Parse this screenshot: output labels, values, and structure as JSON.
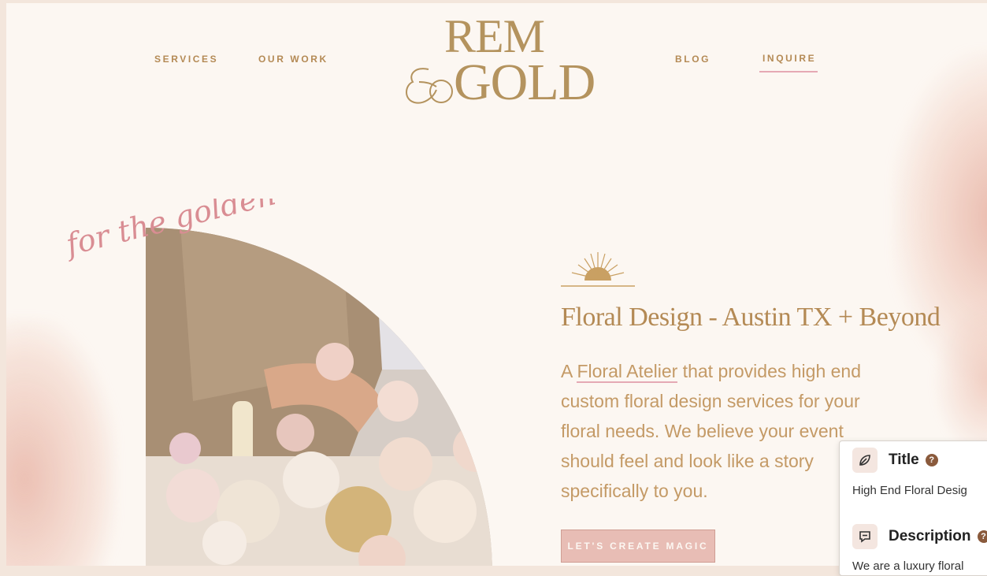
{
  "nav": {
    "services": "SERVICES",
    "our_work": "OUR WORK",
    "blog": "BLOG",
    "inquire": "INQUIRE"
  },
  "logo": {
    "line1": "REM",
    "line2": "GOLD",
    "alt": "Remi & Gold"
  },
  "hero": {
    "script_text": "for the golden",
    "headline": "Floral Design - Austin TX + Beyond",
    "body_prefix": "A ",
    "body_link": "Floral Atelier",
    "body_suffix": " that provides high end custom floral design services for your floral needs. We believe your event should feel and look like a story specifically to you.",
    "cta": "LET'S CREATE MAGIC"
  },
  "seo_panel": {
    "title_label": "Title",
    "title_value": "High End Floral Desig",
    "description_label": "Description",
    "description_value": "We are a luxury floral",
    "help_glyph": "?"
  },
  "colors": {
    "gold": "#b48a55",
    "pink_accent": "#e5a9b4",
    "background": "#fcf7f2",
    "button": "#e8bdb5"
  }
}
